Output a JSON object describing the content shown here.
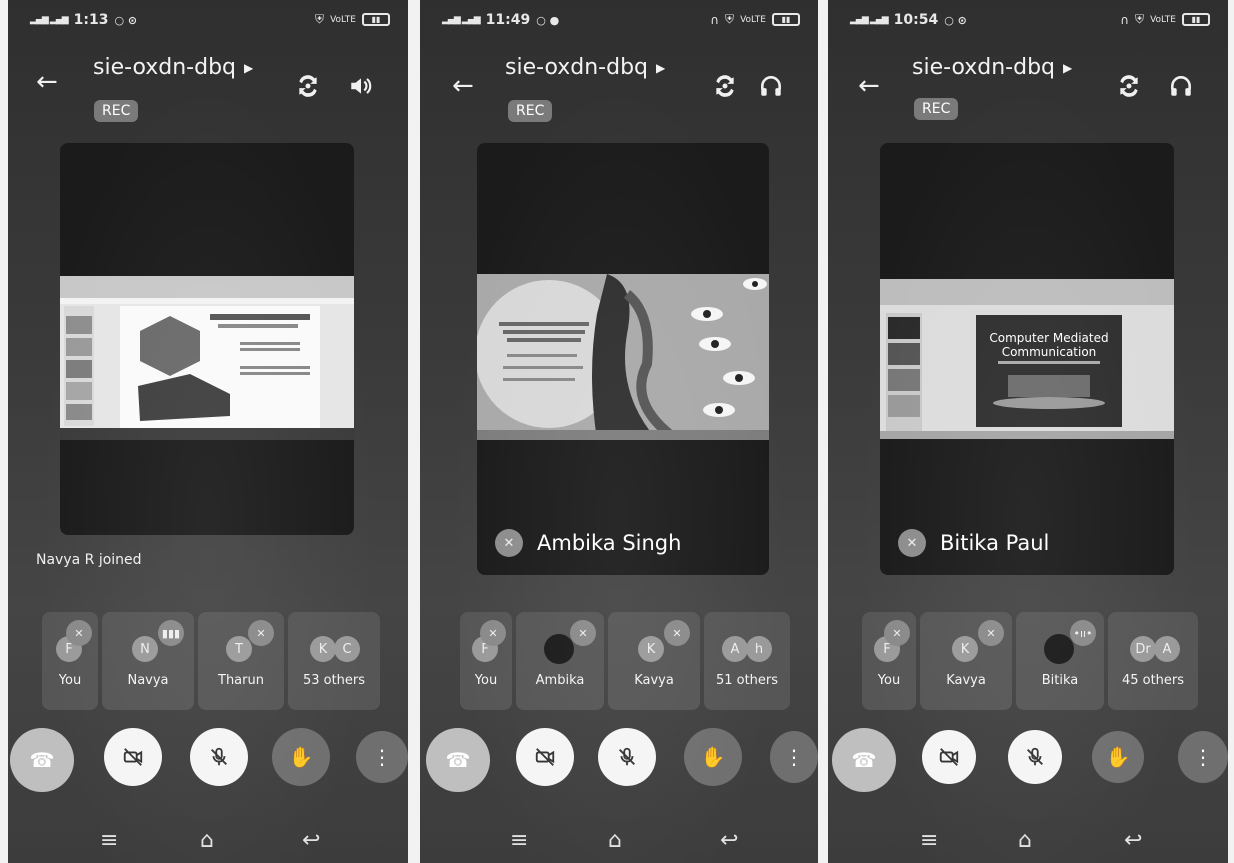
{
  "meeting_code": "sie-oxdn-dbq",
  "rec_label": "REC",
  "phones": [
    {
      "time": "1:13",
      "presenter": "",
      "toast": "Navya R joined",
      "tiles": [
        {
          "label": "You",
          "avatar": "F"
        },
        {
          "label": "Navya",
          "avatar": "N"
        },
        {
          "label": "Tharun",
          "avatar": "T"
        },
        {
          "label": "53 others",
          "avatar": "K",
          "avatar2": "C"
        }
      ]
    },
    {
      "time": "11:49",
      "presenter": "Ambika Singh",
      "toast": "",
      "tiles": [
        {
          "label": "You",
          "avatar": "F"
        },
        {
          "label": "Ambika",
          "avatar": ""
        },
        {
          "label": "Kavya",
          "avatar": "K"
        },
        {
          "label": "51 others",
          "avatar": "A",
          "avatar2": "h"
        }
      ]
    },
    {
      "time": "10:54",
      "presenter": "Bitika Paul",
      "toast": "",
      "slide_title": "Computer Mediated Communication",
      "tiles": [
        {
          "label": "You",
          "avatar": "F"
        },
        {
          "label": "Kavya",
          "avatar": "K"
        },
        {
          "label": "Bitika",
          "avatar": ""
        },
        {
          "label": "45 others",
          "avatar": "Dr",
          "avatar2": "A"
        }
      ]
    }
  ],
  "icons": {
    "back": "arrow-left-icon",
    "switch_camera": "switch-camera-icon",
    "audio": "speaker-icon",
    "headphones": "headphones-icon",
    "end_call": "end-call-icon",
    "camera_off": "camera-off-icon",
    "mic_off": "mic-off-icon",
    "raise_hand": "raise-hand-icon",
    "more": "more-vert-icon"
  }
}
